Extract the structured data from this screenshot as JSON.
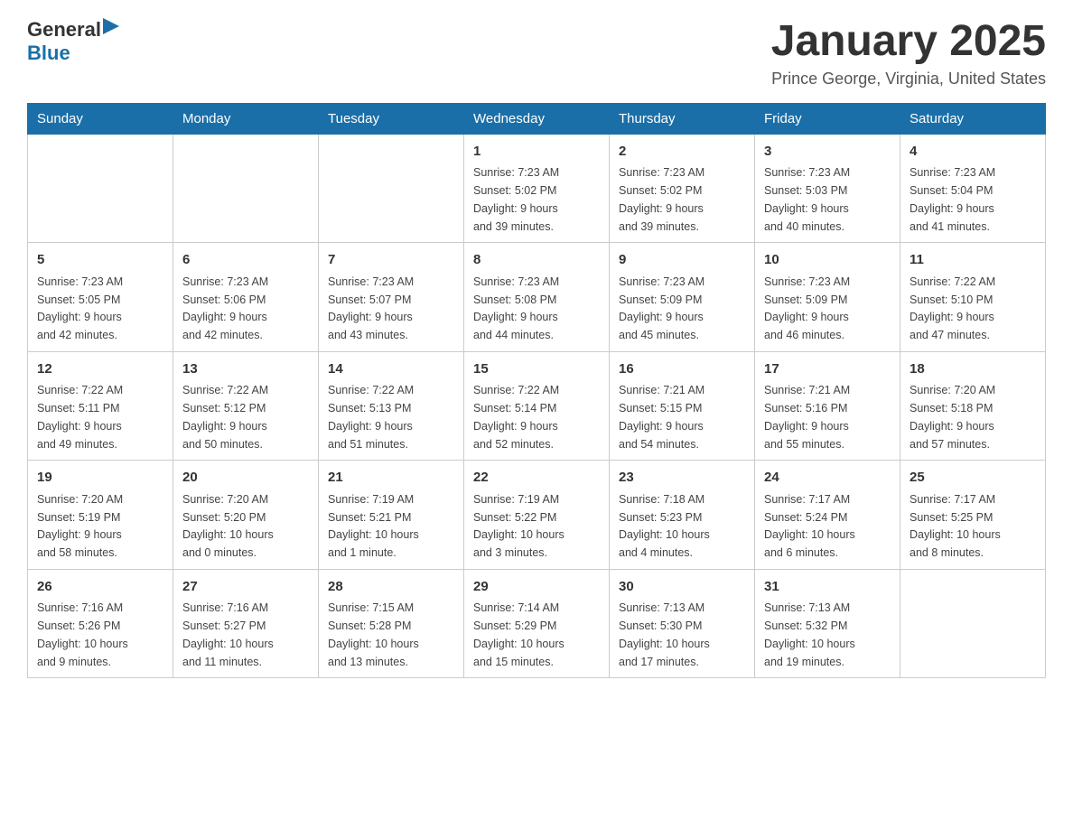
{
  "logo": {
    "general": "General",
    "blue": "Blue"
  },
  "title": "January 2025",
  "location": "Prince George, Virginia, United States",
  "days_of_week": [
    "Sunday",
    "Monday",
    "Tuesday",
    "Wednesday",
    "Thursday",
    "Friday",
    "Saturday"
  ],
  "weeks": [
    [
      {
        "day": "",
        "info": ""
      },
      {
        "day": "",
        "info": ""
      },
      {
        "day": "",
        "info": ""
      },
      {
        "day": "1",
        "info": "Sunrise: 7:23 AM\nSunset: 5:02 PM\nDaylight: 9 hours\nand 39 minutes."
      },
      {
        "day": "2",
        "info": "Sunrise: 7:23 AM\nSunset: 5:02 PM\nDaylight: 9 hours\nand 39 minutes."
      },
      {
        "day": "3",
        "info": "Sunrise: 7:23 AM\nSunset: 5:03 PM\nDaylight: 9 hours\nand 40 minutes."
      },
      {
        "day": "4",
        "info": "Sunrise: 7:23 AM\nSunset: 5:04 PM\nDaylight: 9 hours\nand 41 minutes."
      }
    ],
    [
      {
        "day": "5",
        "info": "Sunrise: 7:23 AM\nSunset: 5:05 PM\nDaylight: 9 hours\nand 42 minutes."
      },
      {
        "day": "6",
        "info": "Sunrise: 7:23 AM\nSunset: 5:06 PM\nDaylight: 9 hours\nand 42 minutes."
      },
      {
        "day": "7",
        "info": "Sunrise: 7:23 AM\nSunset: 5:07 PM\nDaylight: 9 hours\nand 43 minutes."
      },
      {
        "day": "8",
        "info": "Sunrise: 7:23 AM\nSunset: 5:08 PM\nDaylight: 9 hours\nand 44 minutes."
      },
      {
        "day": "9",
        "info": "Sunrise: 7:23 AM\nSunset: 5:09 PM\nDaylight: 9 hours\nand 45 minutes."
      },
      {
        "day": "10",
        "info": "Sunrise: 7:23 AM\nSunset: 5:09 PM\nDaylight: 9 hours\nand 46 minutes."
      },
      {
        "day": "11",
        "info": "Sunrise: 7:22 AM\nSunset: 5:10 PM\nDaylight: 9 hours\nand 47 minutes."
      }
    ],
    [
      {
        "day": "12",
        "info": "Sunrise: 7:22 AM\nSunset: 5:11 PM\nDaylight: 9 hours\nand 49 minutes."
      },
      {
        "day": "13",
        "info": "Sunrise: 7:22 AM\nSunset: 5:12 PM\nDaylight: 9 hours\nand 50 minutes."
      },
      {
        "day": "14",
        "info": "Sunrise: 7:22 AM\nSunset: 5:13 PM\nDaylight: 9 hours\nand 51 minutes."
      },
      {
        "day": "15",
        "info": "Sunrise: 7:22 AM\nSunset: 5:14 PM\nDaylight: 9 hours\nand 52 minutes."
      },
      {
        "day": "16",
        "info": "Sunrise: 7:21 AM\nSunset: 5:15 PM\nDaylight: 9 hours\nand 54 minutes."
      },
      {
        "day": "17",
        "info": "Sunrise: 7:21 AM\nSunset: 5:16 PM\nDaylight: 9 hours\nand 55 minutes."
      },
      {
        "day": "18",
        "info": "Sunrise: 7:20 AM\nSunset: 5:18 PM\nDaylight: 9 hours\nand 57 minutes."
      }
    ],
    [
      {
        "day": "19",
        "info": "Sunrise: 7:20 AM\nSunset: 5:19 PM\nDaylight: 9 hours\nand 58 minutes."
      },
      {
        "day": "20",
        "info": "Sunrise: 7:20 AM\nSunset: 5:20 PM\nDaylight: 10 hours\nand 0 minutes."
      },
      {
        "day": "21",
        "info": "Sunrise: 7:19 AM\nSunset: 5:21 PM\nDaylight: 10 hours\nand 1 minute."
      },
      {
        "day": "22",
        "info": "Sunrise: 7:19 AM\nSunset: 5:22 PM\nDaylight: 10 hours\nand 3 minutes."
      },
      {
        "day": "23",
        "info": "Sunrise: 7:18 AM\nSunset: 5:23 PM\nDaylight: 10 hours\nand 4 minutes."
      },
      {
        "day": "24",
        "info": "Sunrise: 7:17 AM\nSunset: 5:24 PM\nDaylight: 10 hours\nand 6 minutes."
      },
      {
        "day": "25",
        "info": "Sunrise: 7:17 AM\nSunset: 5:25 PM\nDaylight: 10 hours\nand 8 minutes."
      }
    ],
    [
      {
        "day": "26",
        "info": "Sunrise: 7:16 AM\nSunset: 5:26 PM\nDaylight: 10 hours\nand 9 minutes."
      },
      {
        "day": "27",
        "info": "Sunrise: 7:16 AM\nSunset: 5:27 PM\nDaylight: 10 hours\nand 11 minutes."
      },
      {
        "day": "28",
        "info": "Sunrise: 7:15 AM\nSunset: 5:28 PM\nDaylight: 10 hours\nand 13 minutes."
      },
      {
        "day": "29",
        "info": "Sunrise: 7:14 AM\nSunset: 5:29 PM\nDaylight: 10 hours\nand 15 minutes."
      },
      {
        "day": "30",
        "info": "Sunrise: 7:13 AM\nSunset: 5:30 PM\nDaylight: 10 hours\nand 17 minutes."
      },
      {
        "day": "31",
        "info": "Sunrise: 7:13 AM\nSunset: 5:32 PM\nDaylight: 10 hours\nand 19 minutes."
      },
      {
        "day": "",
        "info": ""
      }
    ]
  ]
}
